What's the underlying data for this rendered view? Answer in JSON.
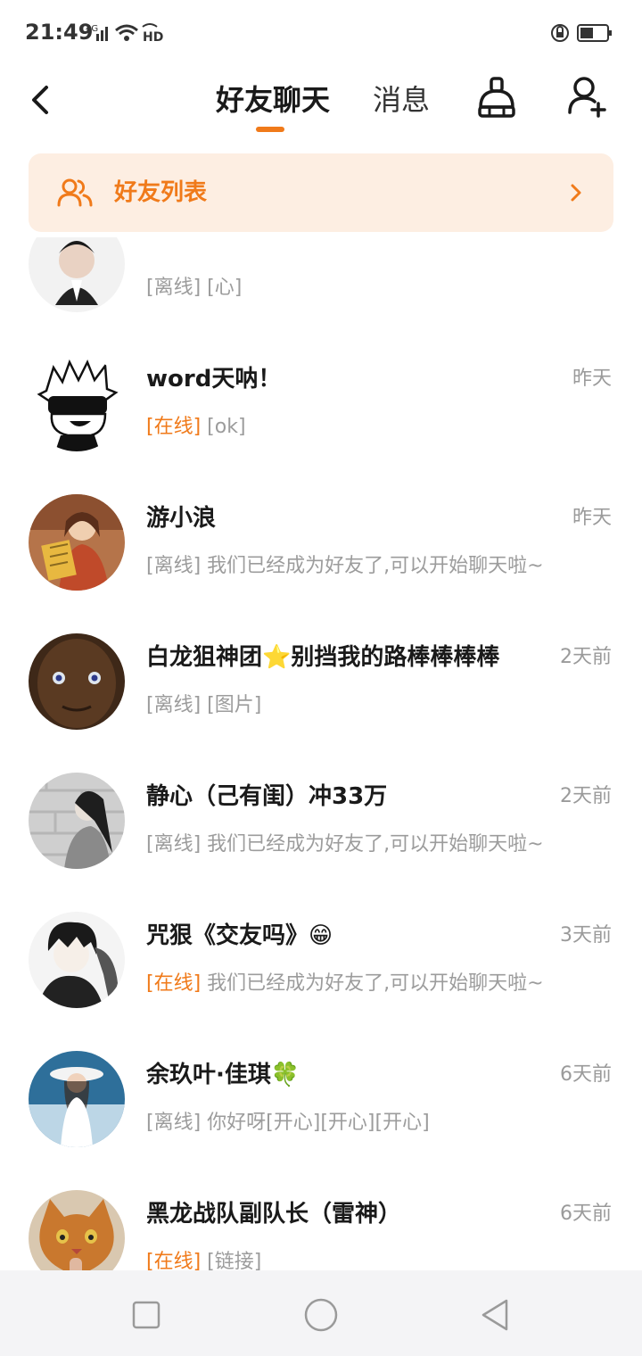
{
  "status_bar": {
    "time": "21:49",
    "network": "4G",
    "hd": "HD"
  },
  "header": {
    "back_icon": "chevron-left-icon",
    "tabs": [
      {
        "label": "好友聊天",
        "active": true
      },
      {
        "label": "消息",
        "active": false
      }
    ],
    "accent": "#f07a1a"
  },
  "banner": {
    "label": "好友列表",
    "icon": "friends-icon",
    "chevron": "chevron-right-icon"
  },
  "chats": [
    {
      "name": "",
      "time": "",
      "status": "[离线]",
      "online": false,
      "preview": "[心]"
    },
    {
      "name": "word天呐！",
      "time": "昨天",
      "status": "[在线]",
      "online": true,
      "preview": "[ok]"
    },
    {
      "name": "游小浪",
      "time": "昨天",
      "status": "[离线]",
      "online": false,
      "preview": "我们已经成为好友了,可以开始聊天啦~"
    },
    {
      "name": "白龙狙神团⭐别挡我的路棒棒棒棒",
      "time": "2天前",
      "status": "[离线]",
      "online": false,
      "preview": "[图片]"
    },
    {
      "name": "静心（己有闺）冲33万",
      "time": "2天前",
      "status": "[离线]",
      "online": false,
      "preview": "我们已经成为好友了,可以开始聊天啦~"
    },
    {
      "name": "咒狠《交友吗》😁",
      "time": "3天前",
      "status": "[在线]",
      "online": true,
      "preview": "我们已经成为好友了,可以开始聊天啦~"
    },
    {
      "name": "余玖叶·佳琪🍀",
      "time": "6天前",
      "status": "[离线]",
      "online": false,
      "preview": "你好呀[开心][开心][开心]"
    },
    {
      "name": "黑龙战队副队长（雷神）",
      "time": "6天前",
      "status": "[在线]",
      "online": true,
      "preview": "[链接]"
    }
  ],
  "colors": {
    "online": "#f07a1a",
    "offline": "#9c9c9c",
    "banner_bg": "#fdeee2"
  }
}
